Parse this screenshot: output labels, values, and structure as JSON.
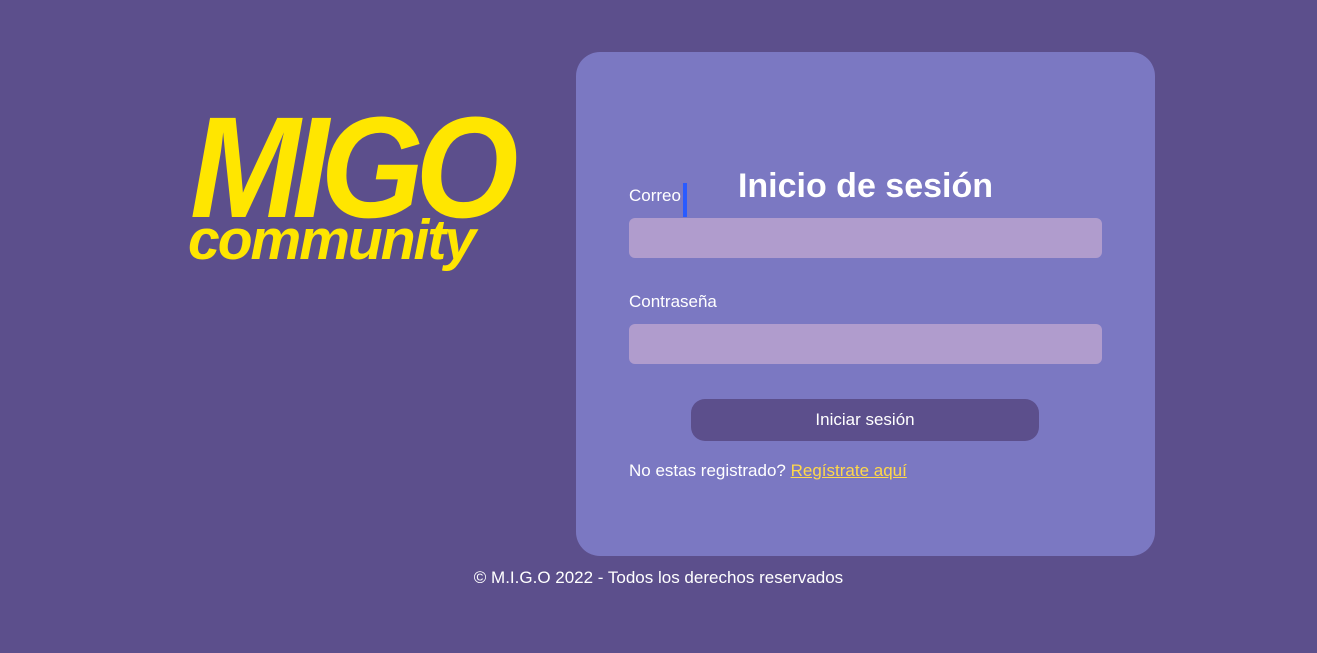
{
  "brand": {
    "logo_main": "MIGO",
    "logo_sub": "community",
    "logo_color": "#ffe600"
  },
  "login": {
    "title": "Inicio de sesión",
    "email_label": "Correo",
    "email_value": "",
    "password_label": "Contraseña",
    "password_value": "",
    "submit_label": "Iniciar sesión",
    "register_prompt": "No estas registrado?",
    "register_link": "Regístrate aquí"
  },
  "footer": {
    "text": "© M.I.G.O 2022 - Todos los derechos reservados"
  },
  "colors": {
    "background": "#5c4f8c",
    "card": "#7b78c2",
    "input": "#b09ccd",
    "link": "#ffd84a",
    "button": "#5c4f8c"
  }
}
